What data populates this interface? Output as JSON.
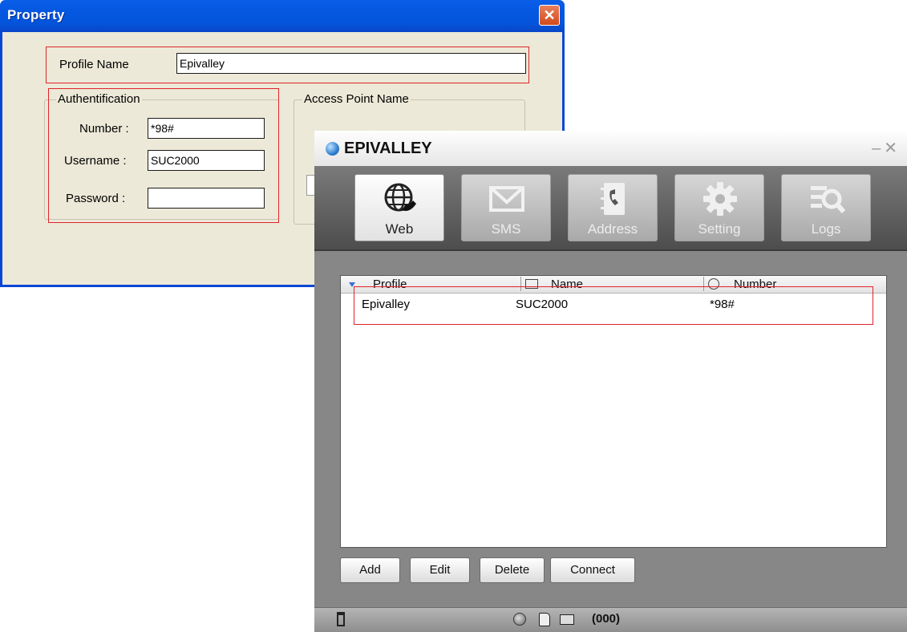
{
  "property": {
    "title": "Property",
    "profile_name_label": "Profile Name",
    "profile_name_value": "Epivalley",
    "auth_group": "Authentification",
    "number_label": "Number :",
    "number_value": "*98#",
    "username_label": "Username :",
    "username_value": "SUC2000",
    "password_label": "Password :",
    "password_value": "",
    "apn_group": "Access Point Name"
  },
  "app": {
    "title": "EPIVALLEY",
    "toolbar": [
      {
        "label": "Web",
        "icon": "globe-phone-icon",
        "active": true
      },
      {
        "label": "SMS",
        "icon": "envelope-icon",
        "active": false
      },
      {
        "label": "Address",
        "icon": "address-book-icon",
        "active": false
      },
      {
        "label": "Setting",
        "icon": "gear-icon",
        "active": false
      },
      {
        "label": "Logs",
        "icon": "logs-search-icon",
        "active": false
      }
    ],
    "columns": [
      "Profile",
      "Name",
      "Number"
    ],
    "rows": [
      {
        "profile": "Epivalley",
        "name": "SUC2000",
        "number": "*98#"
      }
    ],
    "buttons": [
      "Add",
      "Edit",
      "Delete",
      "Connect"
    ],
    "status_counter": "(000)"
  },
  "colors": {
    "xp_title_blue": "#0458e1",
    "highlight_red": "#e0242a",
    "dialog_bg": "#ece9d8",
    "app_dark": "#3a3a3a"
  }
}
